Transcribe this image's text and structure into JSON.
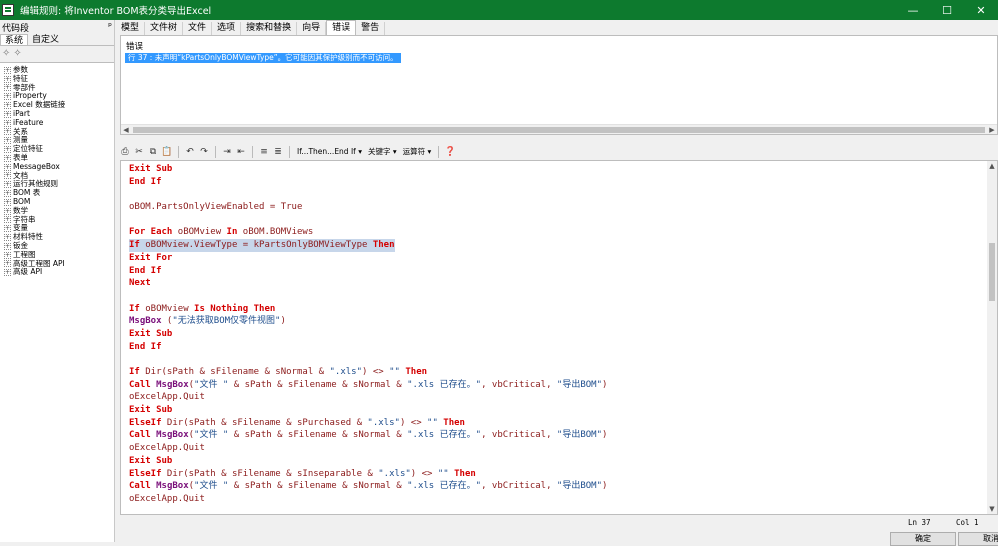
{
  "window": {
    "title": "编辑规则: 将Inventor BOM表分类导出Excel",
    "controls": [
      "—",
      "☐",
      "✕"
    ]
  },
  "left_panel": {
    "header": "代码段",
    "pin": "ᵖ",
    "tabs": [
      "系统",
      "自定义"
    ],
    "tree": [
      "参数",
      "特征",
      "零部件",
      "iProperty",
      "Excel 数据链接",
      "iPart",
      "iFeature",
      "关系",
      "测量",
      "定位特征",
      "表单",
      "MessageBox",
      "文档",
      "运行其他规则",
      "BOM 表",
      "BOM",
      "数学",
      "字符串",
      "变量",
      "材料特性",
      "钣金",
      "工程图",
      "高级工程图 API",
      "高级 API"
    ]
  },
  "tabs": [
    "模型",
    "文件树",
    "文件",
    "选项",
    "搜索和替换",
    "向导",
    "错误",
    "警告"
  ],
  "active_tab": "错误",
  "error_panel": {
    "label": "错误",
    "message": "行 37 : 未声明“kPartsOnlyBOMViewType”。它可能因其保护级别而不可访问。"
  },
  "toolbar": {
    "snippet": "If...Then...End If",
    "keyword": "关键字",
    "operator": "运算符"
  },
  "code_lines": [
    [
      {
        "t": "Exit Sub",
        "c": "kw"
      }
    ],
    [
      {
        "t": "End If",
        "c": "kw"
      }
    ],
    [],
    [
      {
        "t": "oBOM.PartsOnlyViewEnabled = True",
        "c": ""
      }
    ],
    [],
    [
      {
        "t": "For Each",
        "c": "kw"
      },
      {
        "t": " oBOMview ",
        "c": ""
      },
      {
        "t": "In",
        "c": "kw"
      },
      {
        "t": " oBOM.BOMViews",
        "c": ""
      }
    ],
    [
      {
        "t": "If",
        "c": "kw"
      },
      {
        "t": " oBOMview.ViewType = kPartsOnlyBOMViewType ",
        "c": ""
      },
      {
        "t": "Then",
        "c": "kw"
      }
    ],
    [
      {
        "t": "Exit For",
        "c": "kw"
      }
    ],
    [
      {
        "t": "End If",
        "c": "kw"
      }
    ],
    [
      {
        "t": "Next",
        "c": "kw"
      }
    ],
    [],
    [
      {
        "t": "If",
        "c": "kw"
      },
      {
        "t": " oBOMview ",
        "c": ""
      },
      {
        "t": "Is Nothing",
        "c": "kw"
      },
      {
        "t": " ",
        "c": ""
      },
      {
        "t": "Then",
        "c": "kw"
      }
    ],
    [
      {
        "t": "MsgBox",
        "c": "fn"
      },
      {
        "t": " (",
        "c": ""
      },
      {
        "t": "\"无法获取BOM仅零件视图\"",
        "c": "st"
      },
      {
        "t": ")",
        "c": ""
      }
    ],
    [
      {
        "t": "Exit Sub",
        "c": "kw"
      }
    ],
    [
      {
        "t": "End If",
        "c": "kw"
      }
    ],
    [],
    [
      {
        "t": "If",
        "c": "kw"
      },
      {
        "t": " Dir(sPath & sFilename & sNormal & ",
        "c": ""
      },
      {
        "t": "\".xls\"",
        "c": "st"
      },
      {
        "t": ") <> ",
        "c": ""
      },
      {
        "t": "\"\"",
        "c": "st"
      },
      {
        "t": " ",
        "c": ""
      },
      {
        "t": "Then",
        "c": "kw"
      }
    ],
    [
      {
        "t": "Call",
        "c": "kw"
      },
      {
        "t": " ",
        "c": ""
      },
      {
        "t": "MsgBox",
        "c": "fn"
      },
      {
        "t": "(",
        "c": ""
      },
      {
        "t": "\"文件 \"",
        "c": "st"
      },
      {
        "t": " & sPath & sFilename & sNormal & ",
        "c": ""
      },
      {
        "t": "\".xls 已存在。\"",
        "c": "st"
      },
      {
        "t": ", vbCritical, ",
        "c": ""
      },
      {
        "t": "\"导出BOM\"",
        "c": "st"
      },
      {
        "t": ")",
        "c": ""
      }
    ],
    [
      {
        "t": "oExcelApp.Quit",
        "c": ""
      }
    ],
    [
      {
        "t": "Exit Sub",
        "c": "kw"
      }
    ],
    [
      {
        "t": "ElseIf",
        "c": "kw"
      },
      {
        "t": " Dir(sPath & sFilename & sPurchased & ",
        "c": ""
      },
      {
        "t": "\".xls\"",
        "c": "st"
      },
      {
        "t": ") <> ",
        "c": ""
      },
      {
        "t": "\"\"",
        "c": "st"
      },
      {
        "t": " ",
        "c": ""
      },
      {
        "t": "Then",
        "c": "kw"
      }
    ],
    [
      {
        "t": "Call",
        "c": "kw"
      },
      {
        "t": " ",
        "c": ""
      },
      {
        "t": "MsgBox",
        "c": "fn"
      },
      {
        "t": "(",
        "c": ""
      },
      {
        "t": "\"文件 \"",
        "c": "st"
      },
      {
        "t": " & sPath & sFilename & sNormal & ",
        "c": ""
      },
      {
        "t": "\".xls 已存在。\"",
        "c": "st"
      },
      {
        "t": ", vbCritical, ",
        "c": ""
      },
      {
        "t": "\"导出BOM\"",
        "c": "st"
      },
      {
        "t": ")",
        "c": ""
      }
    ],
    [
      {
        "t": "oExcelApp.Quit",
        "c": ""
      }
    ],
    [
      {
        "t": "Exit Sub",
        "c": "kw"
      }
    ],
    [
      {
        "t": "ElseIf",
        "c": "kw"
      },
      {
        "t": " Dir(sPath & sFilename & sInseparable & ",
        "c": ""
      },
      {
        "t": "\".xls\"",
        "c": "st"
      },
      {
        "t": ") <> ",
        "c": ""
      },
      {
        "t": "\"\"",
        "c": "st"
      },
      {
        "t": " ",
        "c": ""
      },
      {
        "t": "Then",
        "c": "kw"
      }
    ],
    [
      {
        "t": "Call",
        "c": "kw"
      },
      {
        "t": " ",
        "c": ""
      },
      {
        "t": "MsgBox",
        "c": "fn"
      },
      {
        "t": "(",
        "c": ""
      },
      {
        "t": "\"文件 \"",
        "c": "st"
      },
      {
        "t": " & sPath & sFilename & sNormal & ",
        "c": ""
      },
      {
        "t": "\".xls 已存在。\"",
        "c": "st"
      },
      {
        "t": ", vbCritical, ",
        "c": ""
      },
      {
        "t": "\"导出BOM\"",
        "c": "st"
      },
      {
        "t": ")",
        "c": ""
      }
    ],
    [
      {
        "t": "oExcelApp.Quit",
        "c": ""
      }
    ]
  ],
  "highlighted_line": 6,
  "status": {
    "line": "Ln 37",
    "col": "Col 1"
  },
  "buttons": {
    "ok": "确定",
    "cancel": "取消"
  }
}
